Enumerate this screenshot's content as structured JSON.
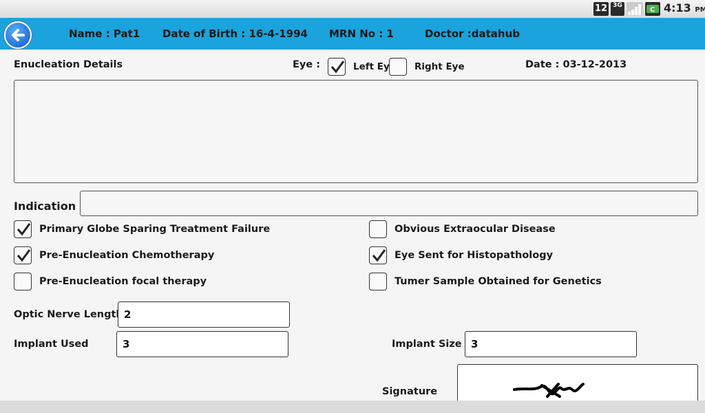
{
  "status_bar": {
    "notification_count": "12",
    "network_label": "3G",
    "time": "4:13",
    "ampm": "PM"
  },
  "header": {
    "name": "Name : Pat1",
    "dob": "Date of Birth : 16-4-1994",
    "mrn": "MRN No : 1",
    "doctor": "Doctor :datahub"
  },
  "form": {
    "section_title": "Enucleation Details",
    "eye_label": "Eye :",
    "left_eye": {
      "label": "Left Eye",
      "checked": true
    },
    "right_eye": {
      "label": "Right Eye",
      "checked": false
    },
    "date": "Date : 03-12-2013",
    "details_text": "",
    "indication_label": "Indication",
    "indication_value": "",
    "checkboxes": [
      {
        "label": "Primary Globe Sparing Treatment Failure",
        "checked": true
      },
      {
        "label": "Obvious Extraocular Disease",
        "checked": false
      },
      {
        "label": "Pre-Enucleation Chemotherapy",
        "checked": true
      },
      {
        "label": "Eye Sent for Histopathology",
        "checked": true
      },
      {
        "label": "Pre-Enucleation focal therapy",
        "checked": false
      },
      {
        "label": "Tumer Sample Obtained for Genetics",
        "checked": false
      }
    ],
    "optic_nerve_label": "Optic Nerve Length",
    "optic_nerve_value": "2",
    "implant_used_label": "Implant Used",
    "implant_used_value": "3",
    "implant_size_label": "Implant Size",
    "implant_size_value": "3",
    "signature_label": "Signature"
  },
  "colors": {
    "header_bg": "#1aa3dc",
    "page_bg": "#f5f5f5"
  }
}
